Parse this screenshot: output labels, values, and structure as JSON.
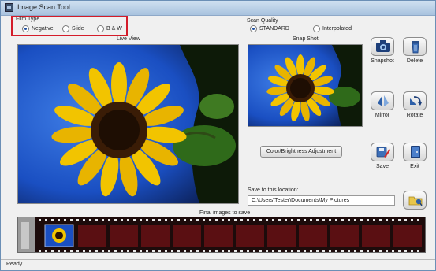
{
  "window": {
    "title": "Image Scan Tool"
  },
  "film_type": {
    "label": "Film Type",
    "options": [
      {
        "label": "Negative",
        "checked": true
      },
      {
        "label": "Slide",
        "checked": false
      },
      {
        "label": "B & W",
        "checked": false
      }
    ]
  },
  "scan_quality": {
    "label": "Scan Quality",
    "options": [
      {
        "label": "STANDARD",
        "checked": true
      },
      {
        "label": "Interpolated",
        "checked": false
      }
    ]
  },
  "live_view": {
    "label": "Live View"
  },
  "snapshot_panel": {
    "label": "Snap Shot"
  },
  "buttons": {
    "snapshot": "Snapshot",
    "delete": "Delete",
    "mirror": "Mirror",
    "rotate": "Rotate",
    "save": "Save",
    "exit": "Exit",
    "adjustment": "Color/Brightness Adjustment"
  },
  "save_location": {
    "label": "Save to this location:",
    "value": "C:\\Users\\Tester\\Documents\\My Pictures"
  },
  "final_images": {
    "label": "Final images to save"
  },
  "status": {
    "text": "Ready"
  },
  "colors": {
    "highlight": "#d41c2a",
    "film": "#5a0f12",
    "sky": "#1a4fc2",
    "petal": "#f2c400"
  },
  "icons": [
    "app-icon",
    "camera-icon",
    "trash-icon",
    "mirror-icon",
    "rotate-icon",
    "save-icon",
    "exit-icon",
    "folder-icon"
  ]
}
